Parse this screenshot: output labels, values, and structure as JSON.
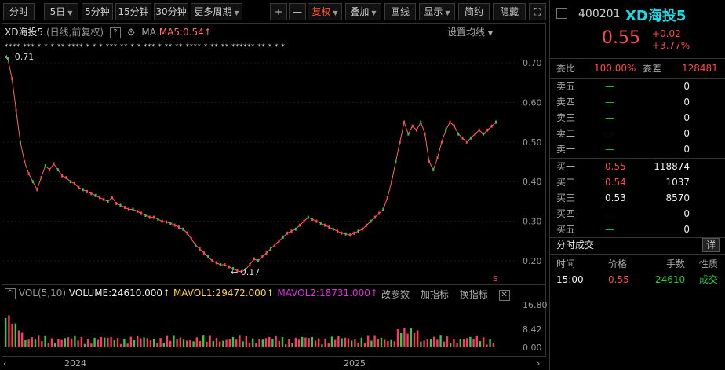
{
  "toolbar": {
    "items": [
      "分时",
      "5日",
      "5分钟",
      "15分钟",
      "30分钟",
      "更多周期"
    ],
    "plus": "+",
    "minus": "—",
    "fuquan": "复权",
    "diejia": "叠加",
    "huaxian": "画线",
    "xianshi": "显示",
    "jianyue": "简约",
    "yincang": "隐藏",
    "fullscreen": "⛶",
    "accent": "#ff5a2a"
  },
  "main_chart": {
    "code_name": "XD海投5",
    "sub": "(日线,前复权)",
    "ma_label": "MA5:0.54",
    "settings": "设置均线",
    "high_label": "0.71",
    "low_label": "0.17",
    "marker": "S"
  },
  "volume": {
    "title": "VOL(5,10)",
    "volume_text": "VOLUME:24610.000",
    "mavol1_text": "MAVOL1:29472.000",
    "mavol2_text": "MAVOL2:18731.000",
    "actions": [
      "改参数",
      "加指标",
      "换指标"
    ]
  },
  "chart_data": {
    "type": "line",
    "price_axis": [
      "0.70",
      "0.60",
      "0.50",
      "0.40",
      "0.30",
      "0.20"
    ],
    "volume_axis": [
      "16.80",
      "8.42",
      "0.00"
    ],
    "x_labels": [
      "2024",
      "2025"
    ],
    "price_series": [
      0.71,
      0.66,
      0.58,
      0.5,
      0.45,
      0.42,
      0.4,
      0.38,
      0.41,
      0.44,
      0.43,
      0.445,
      0.43,
      0.415,
      0.41,
      0.4,
      0.395,
      0.385,
      0.38,
      0.375,
      0.37,
      0.365,
      0.36,
      0.355,
      0.35,
      0.36,
      0.345,
      0.34,
      0.335,
      0.33,
      0.33,
      0.325,
      0.32,
      0.315,
      0.31,
      0.31,
      0.305,
      0.3,
      0.298,
      0.295,
      0.29,
      0.285,
      0.28,
      0.27,
      0.255,
      0.24,
      0.23,
      0.22,
      0.21,
      0.2,
      0.195,
      0.19,
      0.19,
      0.185,
      0.18,
      0.175,
      0.172,
      0.178,
      0.19,
      0.205,
      0.2,
      0.21,
      0.22,
      0.23,
      0.24,
      0.25,
      0.26,
      0.27,
      0.275,
      0.28,
      0.29,
      0.3,
      0.31,
      0.305,
      0.3,
      0.295,
      0.29,
      0.285,
      0.28,
      0.275,
      0.27,
      0.268,
      0.265,
      0.27,
      0.275,
      0.28,
      0.29,
      0.3,
      0.31,
      0.32,
      0.33,
      0.36,
      0.4,
      0.45,
      0.5,
      0.55,
      0.52,
      0.54,
      0.53,
      0.55,
      0.52,
      0.45,
      0.43,
      0.46,
      0.5,
      0.53,
      0.55,
      0.54,
      0.52,
      0.51,
      0.5,
      0.51,
      0.52,
      0.53,
      0.52,
      0.53,
      0.54,
      0.55
    ],
    "ylim": [
      0.15,
      0.75
    ]
  },
  "right_panel": {
    "code": "400201",
    "name": "XD海投5",
    "price": "0.55",
    "change": "+0.02",
    "change_pct": "+3.77%",
    "weibi_label": "委比",
    "weibi_value": "100.00%",
    "weicha_label": "委差",
    "weicha_value": "128481",
    "asks": [
      {
        "label": "卖五",
        "price": "—",
        "vol": "0"
      },
      {
        "label": "卖四",
        "price": "—",
        "vol": "0"
      },
      {
        "label": "卖三",
        "price": "—",
        "vol": "0"
      },
      {
        "label": "卖二",
        "price": "—",
        "vol": "0"
      },
      {
        "label": "卖一",
        "price": "—",
        "vol": "0"
      }
    ],
    "bids": [
      {
        "label": "买一",
        "price": "0.55",
        "vol": "118874",
        "color": "red"
      },
      {
        "label": "买二",
        "price": "0.54",
        "vol": "1037",
        "color": "red"
      },
      {
        "label": "买三",
        "price": "0.53",
        "vol": "8570",
        "color": "wht"
      },
      {
        "label": "买四",
        "price": "—",
        "vol": "0",
        "color": "grn"
      },
      {
        "label": "买五",
        "price": "—",
        "vol": "0",
        "color": "grn"
      }
    ],
    "trades_title": "分时成交",
    "detail": "详",
    "cols": [
      "时间",
      "价格",
      "手数",
      "性质"
    ],
    "trade": {
      "time": "15:00",
      "price": "0.55",
      "vol": "24610",
      "nature": "成交"
    }
  }
}
